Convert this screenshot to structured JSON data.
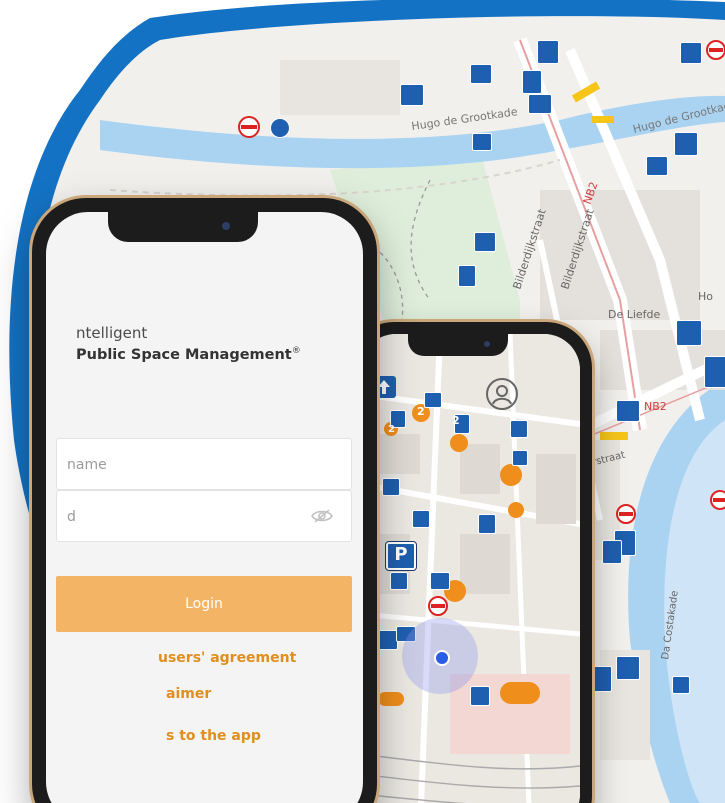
{
  "login": {
    "brand_line1": "ntelligent",
    "brand_line2": "Public Space Management",
    "brand_mark": "®",
    "username_placeholder": "name",
    "password_placeholder": "d",
    "login_button": "Login",
    "users_agreement_link": "users' agreement",
    "disclaimer_link": "aimer",
    "app_link": "s to the app"
  },
  "map_labels": {
    "street_hugo_1": "Hugo de Grootkade",
    "street_hugo_2": "Hugo de Grootkade",
    "street_bilderdijk_1": "Bilderdijkstraat",
    "street_bilderdijk_2": "Bilderdijkstraat",
    "street_de_liefde": "De Liefde",
    "street_nb2_1": "NB2",
    "street_nb2_2": "NB2",
    "street_costakade": "Da Costakade",
    "street_leerstraat": "erstraat",
    "poi_label": "Ho"
  },
  "mobile_map": {
    "cluster_counts": [
      "2",
      "2",
      "2"
    ]
  },
  "colors": {
    "frame_blue": "#1472c4",
    "sign_blue": "#1f5fb0",
    "accent_orange": "#f3b466",
    "link_orange": "#e08f1e",
    "water": "#aad3f2",
    "park": "#dfeedb"
  },
  "icons": [
    "eye-icon",
    "profile-icon",
    "location-dot-icon",
    "arrow-up-icon",
    "parking-sign-icon",
    "bicycle-sign-icon",
    "no-entry-sign-icon"
  ]
}
